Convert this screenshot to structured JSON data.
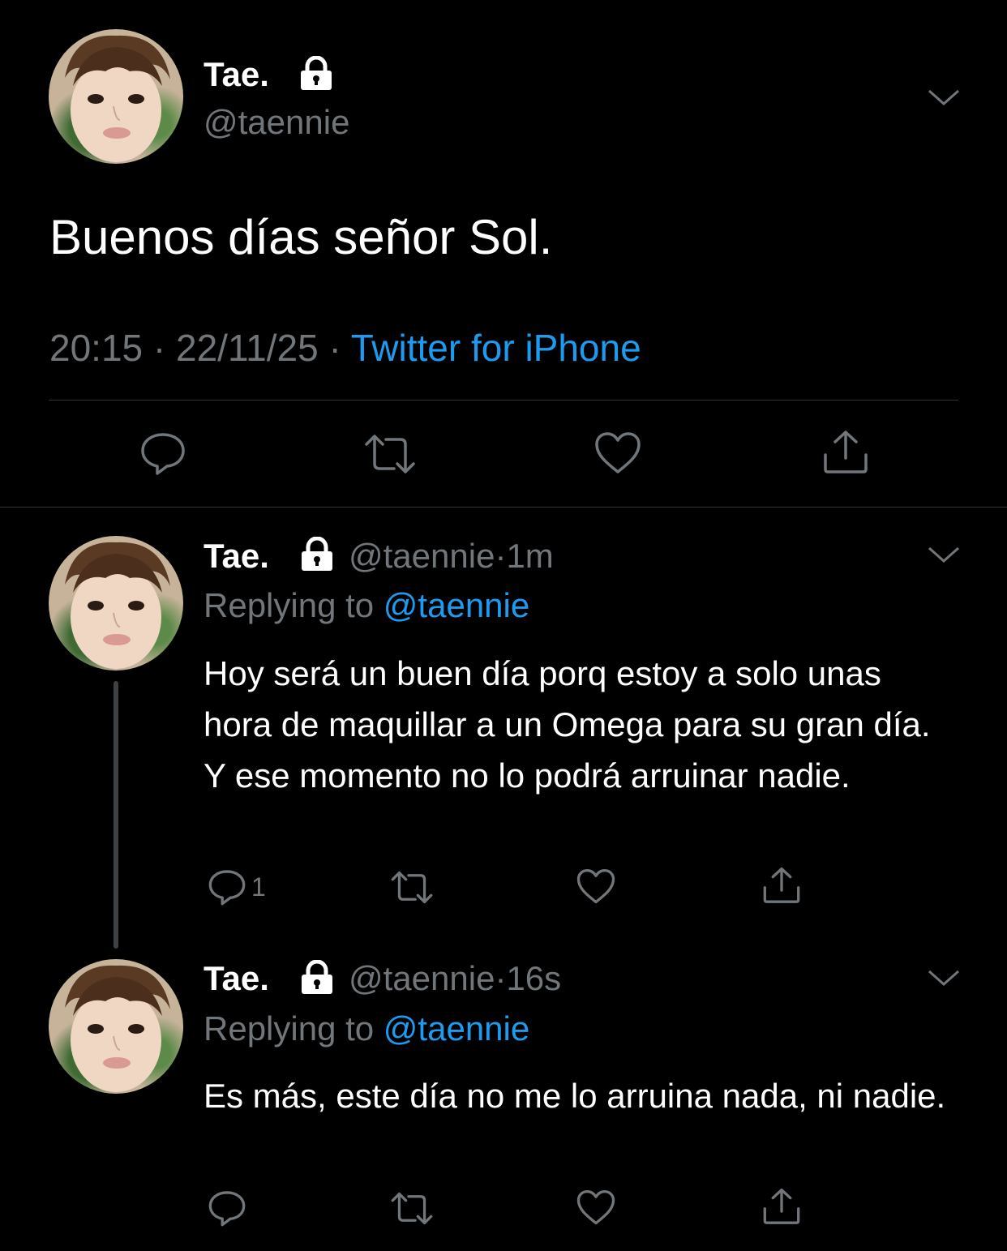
{
  "colors": {
    "background": "#000000",
    "text": "#ffffff",
    "muted": "#71767b",
    "link": "#1d9bf0",
    "divider": "#2f3336"
  },
  "main_tweet": {
    "name": "Tae.",
    "handle": "@taennie",
    "text": "Buenos días señor Sol.",
    "time": "20:15",
    "separator1": "·",
    "date": "22/11/25",
    "separator2": "·",
    "source": "Twitter for iPhone",
    "icons": [
      "lock-icon",
      "chevron-down-icon",
      "reply-icon",
      "retweet-icon",
      "like-icon",
      "share-icon"
    ]
  },
  "replies": [
    {
      "name": "Tae.",
      "handle": "@taennie",
      "dot": "·",
      "time": "1m",
      "replying_label": "Replying to",
      "replying_handle": "@taennie",
      "text": "Hoy será un buen día porq estoy a solo unas hora de maquillar a un Omega para su gran día. Y ese momento no lo podrá arruinar nadie.",
      "reply_count": "1"
    },
    {
      "name": "Tae.",
      "handle": "@taennie",
      "dot": "·",
      "time": "16s",
      "replying_label": "Replying to",
      "replying_handle": "@taennie",
      "text": "Es más, este día no me lo arruina nada, ni nadie.",
      "reply_count": ""
    }
  ]
}
